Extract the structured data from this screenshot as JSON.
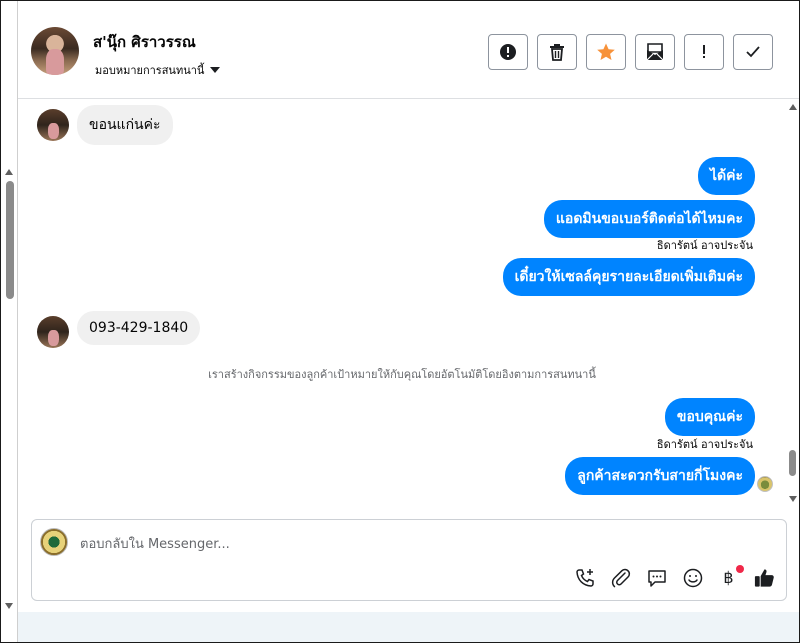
{
  "header": {
    "contact_name": "ส'นุ๊ก ศิราวรรณ",
    "assign_label": "มอบหมายการสนทนานี้",
    "toolbar": [
      {
        "name": "spam-button",
        "icon": "alert-circle-icon"
      },
      {
        "name": "delete-button",
        "icon": "trash-icon"
      },
      {
        "name": "star-button",
        "icon": "star-icon"
      },
      {
        "name": "mark-unread-button",
        "icon": "envelope-icon"
      },
      {
        "name": "follow-up-button",
        "icon": "exclamation-icon"
      },
      {
        "name": "done-button",
        "icon": "check-icon"
      }
    ]
  },
  "messages": {
    "in_1": "ขอนแก่นค่ะ",
    "out_1": "ได้ค่ะ",
    "out_2": "แอดมินขอเบอร์ติดต่อได้ไหมคะ",
    "sender_1": "ธิดารัตน์ อาจประจัน",
    "out_3": "เดี๋ยวให้เซลล์คุยรายละเอียดเพิ่มเติมค่ะ",
    "in_2": "093-429-1840",
    "system_note": "เราสร้างกิจกรรมของลูกค้าเป้าหมายให้กับคุณโดยอัตโนมัติโดยอิงตามการสนทนานี้",
    "out_4": "ขอบคุณค่ะ",
    "sender_2": "ธิดารัตน์ อาจประจัน",
    "out_5": "ลูกค้าสะดวกรับสายกี่โมงคะ"
  },
  "composer": {
    "placeholder": "ตอบกลับใน Messenger...",
    "currency_symbol": "฿"
  },
  "colors": {
    "outgoing_bubble": "#0084ff",
    "incoming_bubble": "#f0f0f0",
    "star": "#f7923a",
    "notification_dot": "#f02849"
  }
}
